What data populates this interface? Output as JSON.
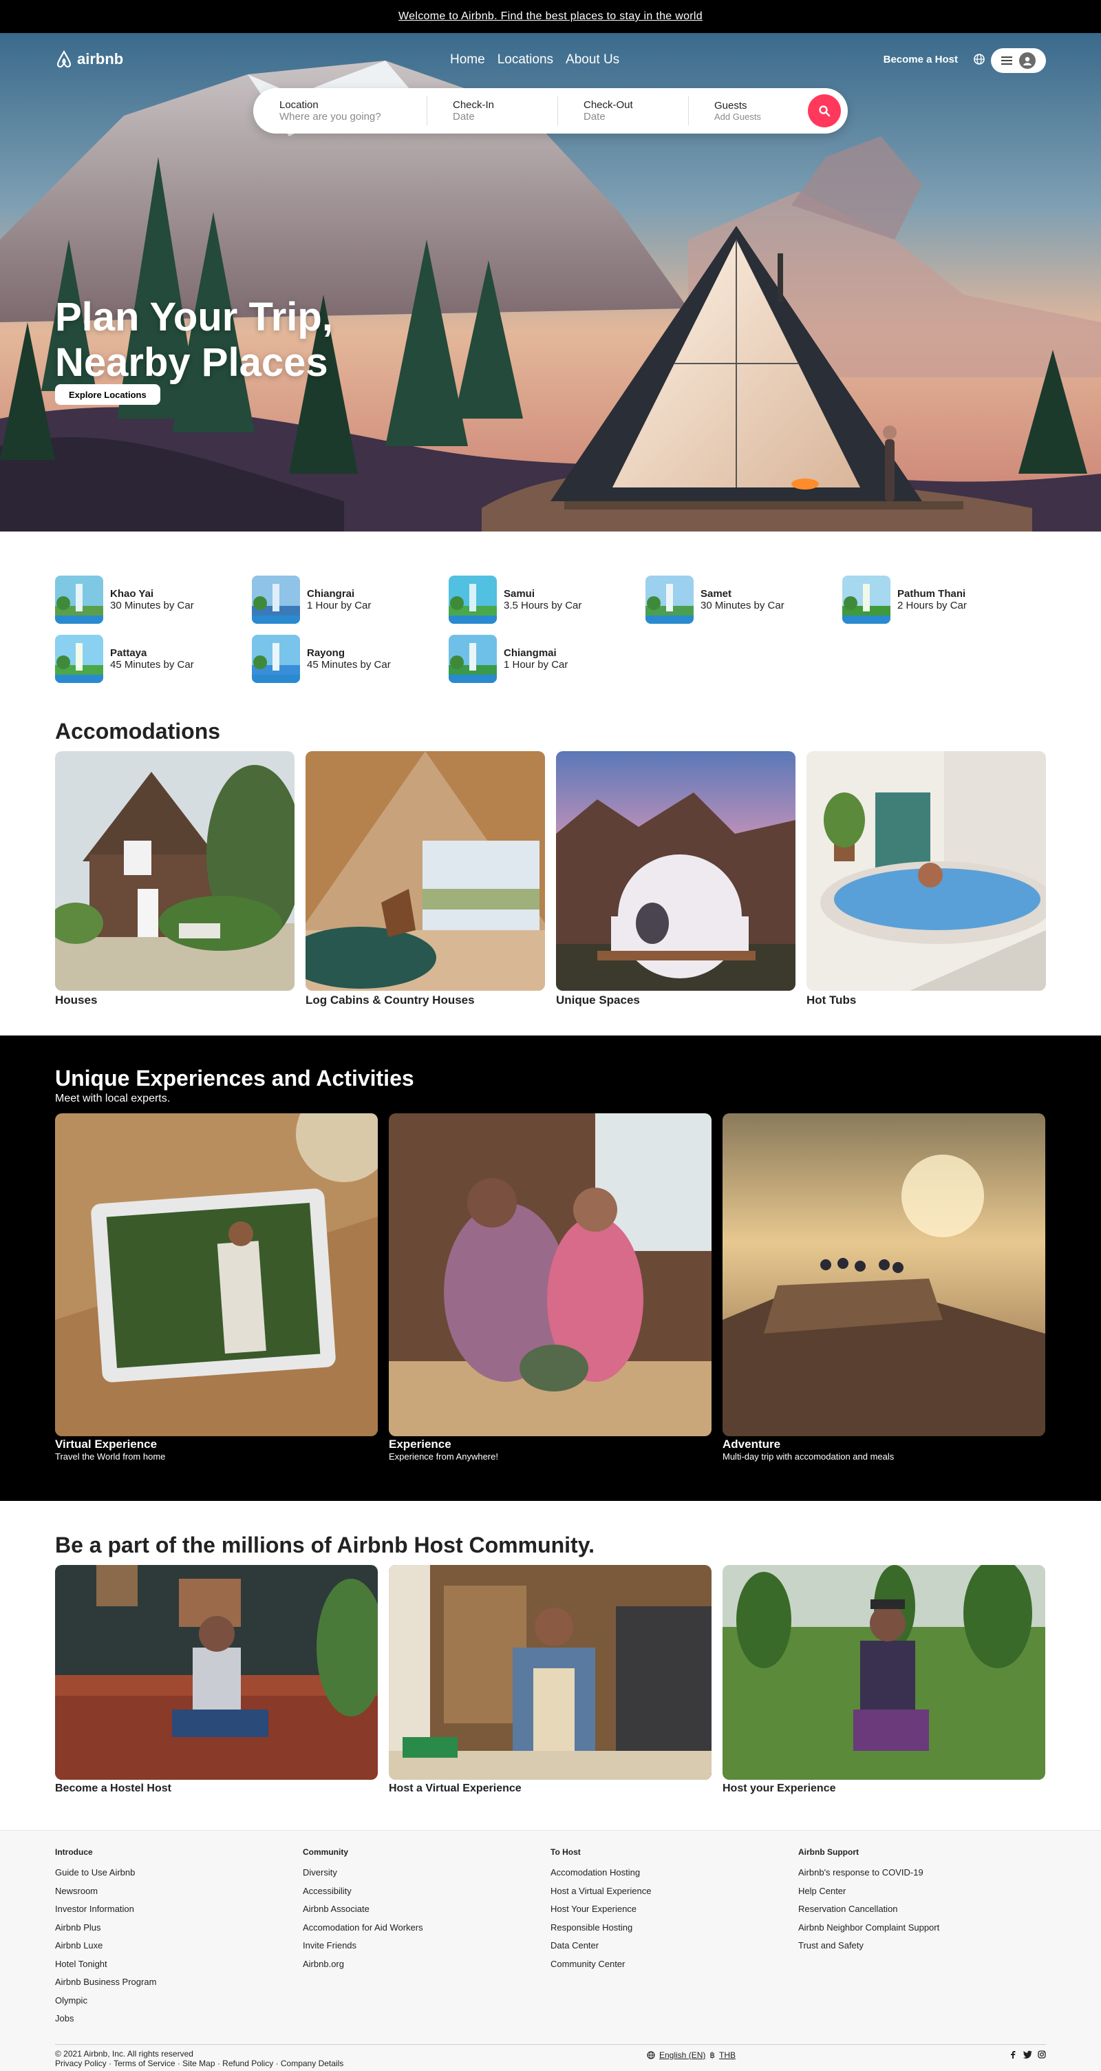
{
  "banner": {
    "text": "Welcome to Airbnb. Find the best places to stay in the world"
  },
  "nav": {
    "logo": "airbnb",
    "menu": [
      "Home",
      "Locations",
      "About Us"
    ],
    "become_host": "Become a Host"
  },
  "search": {
    "location_label": "Location",
    "location_placeholder": "Where are you going?",
    "checkin_label": "Check-In",
    "checkin_placeholder": "Date",
    "checkout_label": "Check-Out",
    "checkout_placeholder": "Date",
    "guests_label": "Guests",
    "guests_placeholder": "Add Guests"
  },
  "hero": {
    "title_line1": "Plan Your Trip,",
    "title_line2": "Nearby Places",
    "cta": "Explore Locations"
  },
  "nearby": [
    {
      "name": "Khao Yai",
      "distance": "30 Minutes by Car"
    },
    {
      "name": "Chiangrai",
      "distance": "1 Hour by Car"
    },
    {
      "name": "Samui",
      "distance": "3.5 Hours by Car"
    },
    {
      "name": "Samet",
      "distance": "30 Minutes by Car"
    },
    {
      "name": "Pathum Thani",
      "distance": "2 Hours by Car"
    },
    {
      "name": "Pattaya",
      "distance": "45 Minutes by Car"
    },
    {
      "name": "Rayong",
      "distance": "45 Minutes by Car"
    },
    {
      "name": "Chiangmai",
      "distance": "1 Hour by Car"
    }
  ],
  "accommodations": {
    "heading": "Accomodations",
    "items": [
      "Houses",
      "Log Cabins & Country Houses",
      "Unique Spaces",
      "Hot Tubs"
    ]
  },
  "experiences": {
    "heading": "Unique Experiences and Activities",
    "subheading": "Meet with local experts.",
    "items": [
      {
        "title": "Virtual Experience",
        "desc": "Travel the World from home"
      },
      {
        "title": "Experience",
        "desc": "Experience from Anywhere!"
      },
      {
        "title": "Adventure",
        "desc": "Multi-day trip with accomodation and meals"
      }
    ]
  },
  "host": {
    "heading": "Be a part of the millions of Airbnb Host Community.",
    "items": [
      "Become a Hostel Host",
      "Host a Virtual Experience",
      "Host your Experience"
    ]
  },
  "footer": {
    "columns": [
      {
        "title": "Introduce",
        "links": [
          "Guide to Use Airbnb",
          "Newsroom",
          "Investor Information",
          "Airbnb Plus",
          "Airbnb Luxe",
          "Hotel Tonight",
          "Airbnb Business Program",
          "Olympic",
          "Jobs"
        ]
      },
      {
        "title": "Community",
        "links": [
          "Diversity",
          "Accessibility",
          "Airbnb Associate",
          "Accomodation for Aid Workers",
          "Invite Friends",
          "Airbnb.org"
        ]
      },
      {
        "title": "To Host",
        "links": [
          "Accomodation Hosting",
          "Host a Virtual Experience",
          "Host Your Experience",
          "Responsible Hosting",
          "Data Center",
          "Community Center"
        ]
      },
      {
        "title": "Airbnb Support",
        "links": [
          "Airbnb's response to COVID-19",
          "Help Center",
          "Reservation Cancellation",
          "Airbnb Neighbor Complaint Support",
          "Trust and Safety"
        ]
      }
    ],
    "copyright": "© 2021 Airbnb, Inc. All rights reserved",
    "legal": "Privacy Policy · Terms of Service · Site Map · Refund Policy · Company Details",
    "language": "English (EN)",
    "currency": "THB"
  },
  "colors": {
    "brand": "#ff385c",
    "dark": "#000000"
  }
}
